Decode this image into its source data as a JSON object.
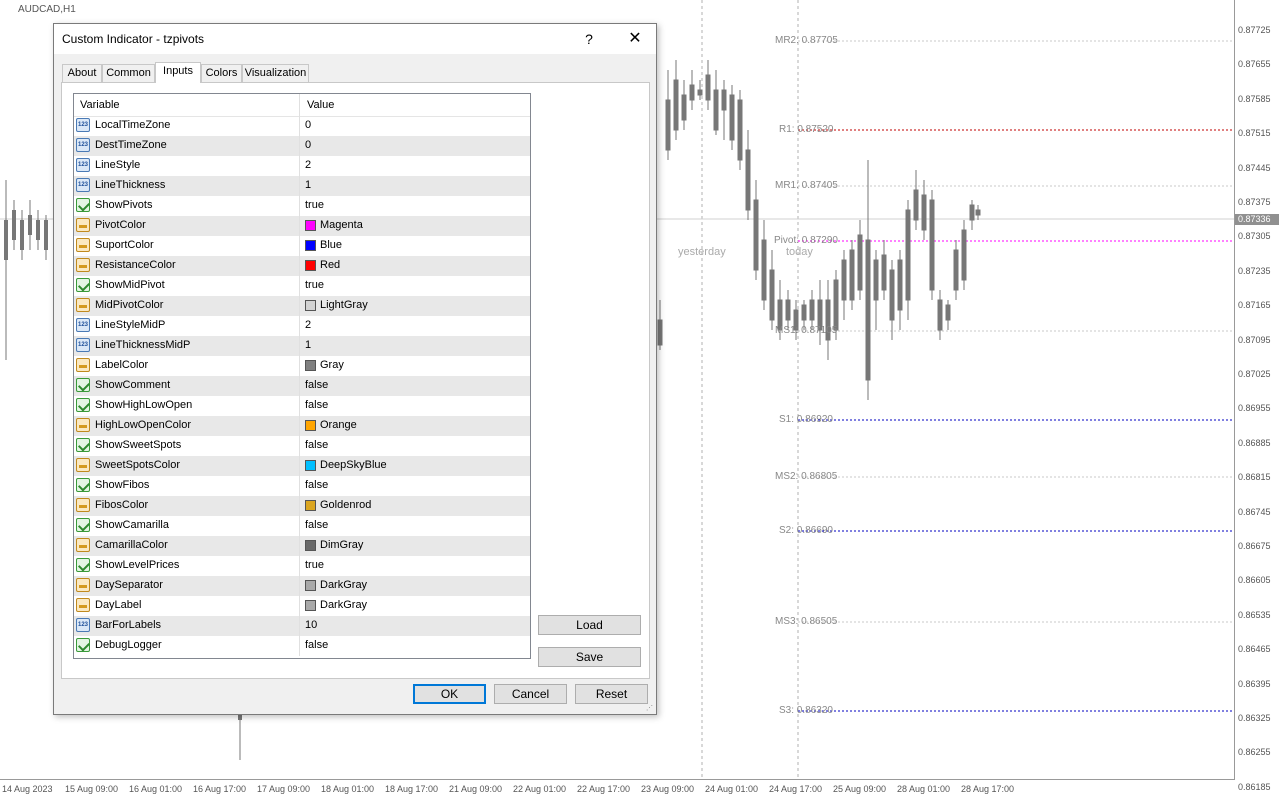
{
  "chart": {
    "symbol": "AUDCAD,H1",
    "current_price": "0.87336",
    "price_axis": [
      "0.87725",
      "0.87655",
      "0.87585",
      "0.87515",
      "0.87445",
      "0.87375",
      "0.87305",
      "0.87235",
      "0.87165",
      "0.87095",
      "0.87025",
      "0.86955",
      "0.86885",
      "0.86815",
      "0.86745",
      "0.86675",
      "0.86605",
      "0.86535",
      "0.86465",
      "0.86395",
      "0.86325",
      "0.86255",
      "0.86185"
    ],
    "time_axis": [
      "14 Aug 2023",
      "15 Aug 09:00",
      "16 Aug 01:00",
      "16 Aug 17:00",
      "17 Aug 09:00",
      "18 Aug 01:00",
      "18 Aug 17:00",
      "21 Aug 09:00",
      "22 Aug 01:00",
      "22 Aug 17:00",
      "23 Aug 09:00",
      "24 Aug 01:00",
      "24 Aug 17:00",
      "25 Aug 09:00",
      "28 Aug 01:00",
      "28 Aug 17:00"
    ],
    "pivots": [
      {
        "label": "MR2: 0.87705",
        "color": "#c8c8c8"
      },
      {
        "label": "R1: 0.87520",
        "color": "#c00000"
      },
      {
        "label": "MR1: 0.87405",
        "color": "#c8c8c8"
      },
      {
        "label": "Pivot: 0.87290",
        "color": "#ff00ff"
      },
      {
        "label": "MS1: 0.87105",
        "color": "#c8c8c8"
      },
      {
        "label": "S1: 0.86920",
        "color": "#0000c0"
      },
      {
        "label": "MS2: 0.86805",
        "color": "#c8c8c8"
      },
      {
        "label": "S2: 0.86690",
        "color": "#0000c0"
      },
      {
        "label": "MS3: 0.86505",
        "color": "#c8c8c8"
      },
      {
        "label": "S3: 0.86320",
        "color": "#0000c0"
      }
    ],
    "day_labels": {
      "yesterday": "yesterday",
      "today": "today"
    }
  },
  "dialog": {
    "title": "Custom Indicator - tzpivots",
    "help": "?",
    "close": "✕",
    "tabs": [
      "About",
      "Common",
      "Inputs",
      "Colors",
      "Visualization"
    ],
    "active_tab": "Inputs",
    "columns": {
      "variable": "Variable",
      "value": "Value"
    },
    "rows": [
      {
        "icon": "num",
        "name": "LocalTimeZone",
        "value": "0"
      },
      {
        "icon": "num",
        "name": "DestTimeZone",
        "value": "0"
      },
      {
        "icon": "num",
        "name": "LineStyle",
        "value": "2"
      },
      {
        "icon": "num",
        "name": "LineThickness",
        "value": "1"
      },
      {
        "icon": "bool",
        "name": "ShowPivots",
        "value": "true"
      },
      {
        "icon": "col",
        "name": "PivotColor",
        "value": "Magenta",
        "swatch": "#ff00ff"
      },
      {
        "icon": "col",
        "name": "SuportColor",
        "value": "Blue",
        "swatch": "#0000ff"
      },
      {
        "icon": "col",
        "name": "ResistanceColor",
        "value": "Red",
        "swatch": "#ff0000"
      },
      {
        "icon": "bool",
        "name": "ShowMidPivot",
        "value": "true"
      },
      {
        "icon": "col",
        "name": "MidPivotColor",
        "value": "LightGray",
        "swatch": "#d3d3d3"
      },
      {
        "icon": "num",
        "name": "LineStyleMidP",
        "value": "2"
      },
      {
        "icon": "num",
        "name": "LineThicknessMidP",
        "value": "1"
      },
      {
        "icon": "col",
        "name": "LabelColor",
        "value": "Gray",
        "swatch": "#808080"
      },
      {
        "icon": "bool",
        "name": "ShowComment",
        "value": "false"
      },
      {
        "icon": "bool",
        "name": "ShowHighLowOpen",
        "value": "false"
      },
      {
        "icon": "col",
        "name": "HighLowOpenColor",
        "value": "Orange",
        "swatch": "#ffa500"
      },
      {
        "icon": "bool",
        "name": "ShowSweetSpots",
        "value": "false"
      },
      {
        "icon": "col",
        "name": "SweetSpotsColor",
        "value": "DeepSkyBlue",
        "swatch": "#00bfff"
      },
      {
        "icon": "bool",
        "name": "ShowFibos",
        "value": "false"
      },
      {
        "icon": "col",
        "name": "FibosColor",
        "value": "Goldenrod",
        "swatch": "#daa520"
      },
      {
        "icon": "bool",
        "name": "ShowCamarilla",
        "value": "false"
      },
      {
        "icon": "col",
        "name": "CamarillaColor",
        "value": "DimGray",
        "swatch": "#696969"
      },
      {
        "icon": "bool",
        "name": "ShowLevelPrices",
        "value": "true"
      },
      {
        "icon": "col",
        "name": "DaySeparator",
        "value": "DarkGray",
        "swatch": "#a9a9a9"
      },
      {
        "icon": "col",
        "name": "DayLabel",
        "value": "DarkGray",
        "swatch": "#a9a9a9"
      },
      {
        "icon": "num",
        "name": "BarForLabels",
        "value": "10"
      },
      {
        "icon": "bool",
        "name": "DebugLogger",
        "value": "false"
      }
    ],
    "buttons": {
      "load": "Load",
      "save": "Save",
      "ok": "OK",
      "cancel": "Cancel",
      "reset": "Reset"
    }
  }
}
